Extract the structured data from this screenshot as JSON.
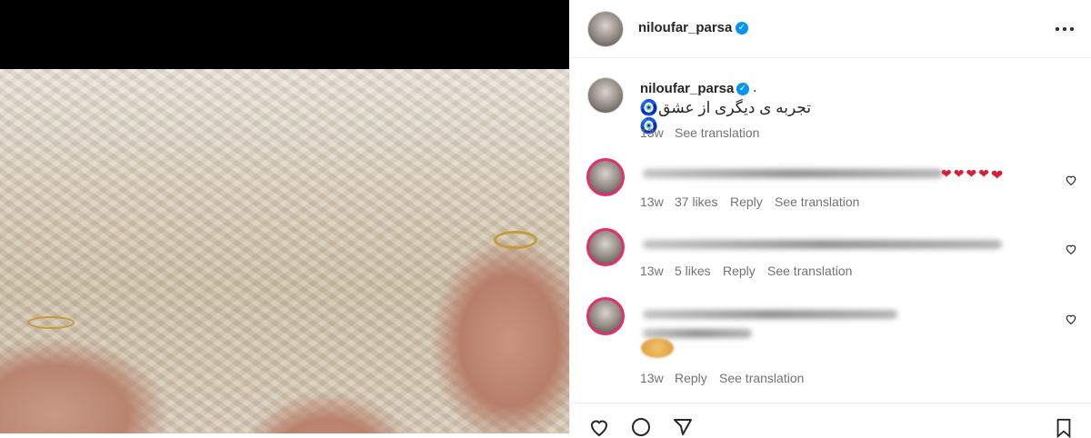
{
  "post": {
    "username": "niloufar_parsa",
    "caption_username": "niloufar_parsa",
    "caption_dot": ".",
    "caption_text": "تجربه ی دیگری از عشق🧿🧿",
    "caption_time": "13w",
    "caption_translate": "See translation"
  },
  "comments": [
    {
      "time": "13w",
      "likes": "37 likes",
      "reply": "Reply",
      "translate": "See translation"
    },
    {
      "time": "13w",
      "likes": "5 likes",
      "reply": "Reply",
      "translate": "See translation"
    },
    {
      "time": "13w",
      "likes": "",
      "reply": "Reply",
      "translate": "See translation"
    }
  ],
  "icons": {
    "verified": "verified-badge-icon",
    "more": "more-options-icon",
    "like": "heart-outline-icon",
    "comment": "comment-icon",
    "share": "share-icon",
    "save": "bookmark-icon"
  },
  "colors": {
    "verified": "#0095f6",
    "text": "#262626",
    "muted": "#737373"
  }
}
